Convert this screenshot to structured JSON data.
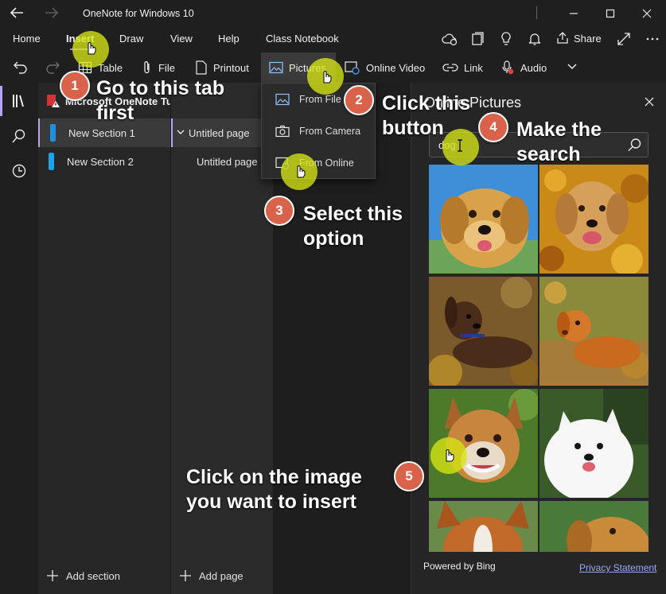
{
  "window": {
    "title": "OneNote for Windows 10"
  },
  "menu": {
    "items": [
      {
        "label": "Home"
      },
      {
        "label": "Insert",
        "active": true
      },
      {
        "label": "Draw"
      },
      {
        "label": "View"
      },
      {
        "label": "Help"
      },
      {
        "label": "Class Notebook"
      }
    ],
    "share_label": "Share"
  },
  "toolbar": {
    "table": "Table",
    "file": "File",
    "printout": "Printout",
    "pictures": "Pictures",
    "online_video": "Online Video",
    "link": "Link",
    "audio": "Audio"
  },
  "pictures_menu": {
    "items": [
      {
        "label": "From File",
        "icon": "image-icon"
      },
      {
        "label": "From Camera",
        "icon": "camera-icon"
      },
      {
        "label": "From Online",
        "icon": "globe-image-icon"
      }
    ]
  },
  "notebook": {
    "title": "Microsoft OneNote Tutorial",
    "sections": [
      {
        "label": "New Section 1",
        "color": "#1e8fe1",
        "selected": true
      },
      {
        "label": "New Section 2",
        "color": "#1aa5e8",
        "selected": false
      }
    ],
    "pages": [
      {
        "label": "Untitled page",
        "selected": true
      },
      {
        "label": "Untitled page",
        "selected": false
      }
    ],
    "add_section": "Add section",
    "add_page": "Add page"
  },
  "online_pictures": {
    "title": "Online Pictures",
    "search_value": "dog",
    "powered_by": "Powered by Bing",
    "privacy": "Privacy Statement"
  },
  "callouts": [
    {
      "number": "1",
      "text": "Go to this tab\nfirst"
    },
    {
      "number": "2",
      "text": "Click this\nbutton"
    },
    {
      "number": "3",
      "text": "Select this\noption"
    },
    {
      "number": "4",
      "text": "Make the\nsearch"
    },
    {
      "number": "5",
      "text": "Click on the image\nyou want to insert"
    }
  ],
  "colors": {
    "accent": "#b6a3ff",
    "callout": "#d9634a",
    "highlight": "#d6e614"
  }
}
